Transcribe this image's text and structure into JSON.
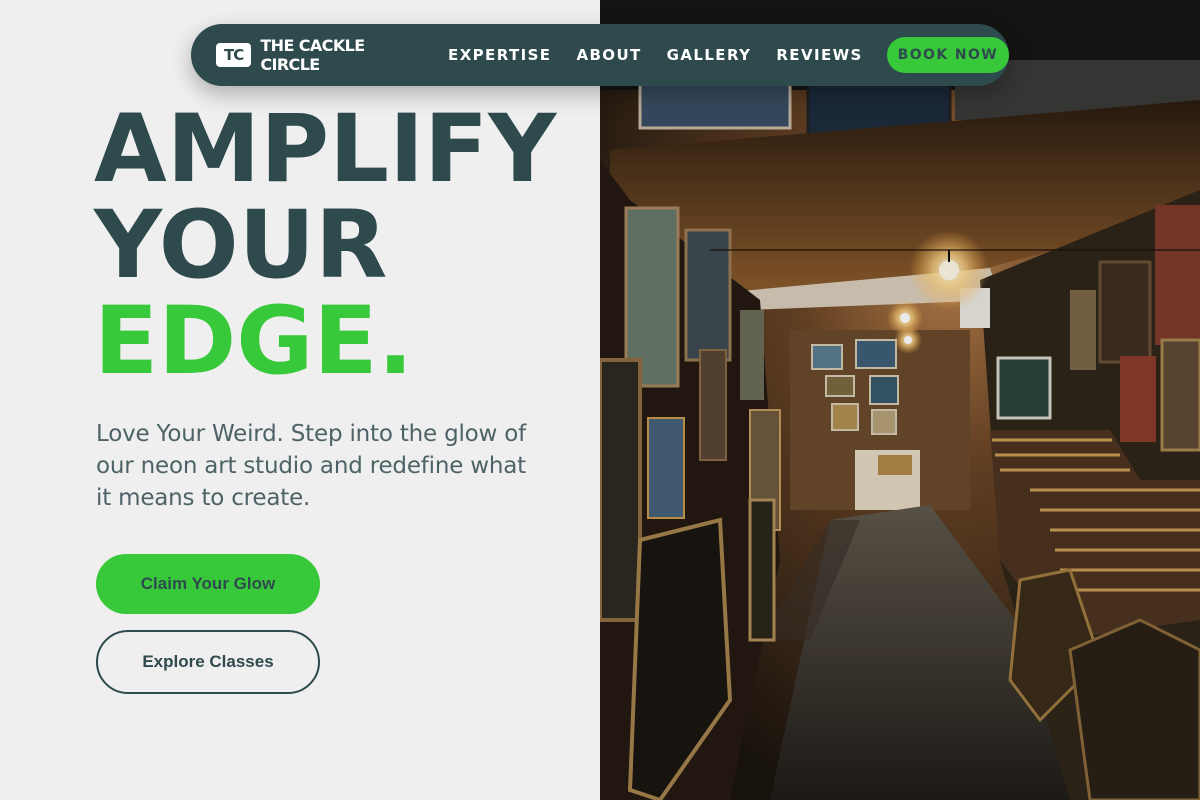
{
  "brand": {
    "logo_text": "TC",
    "name": "THE CACKLE CIRCLE"
  },
  "nav": {
    "links": [
      "EXPERTISE",
      "ABOUT",
      "GALLERY",
      "REVIEWS"
    ],
    "cta_label": "BOOK NOW"
  },
  "hero": {
    "headline_line1": "AMPLIFY",
    "headline_line2": "YOUR",
    "headline_line3": "EDGE.",
    "tagline": "Love Your Weird. Step into the glow of our neon art studio and redefine what it means to create.",
    "primary_button": "Claim Your Glow",
    "secondary_button": "Explore Classes"
  },
  "colors": {
    "navy": "#2e4a4d",
    "accent_green": "#37c93a",
    "background": "#efefef",
    "body_text": "#4d6366"
  },
  "image": {
    "subject": "art-gallery-corridor-photo"
  }
}
